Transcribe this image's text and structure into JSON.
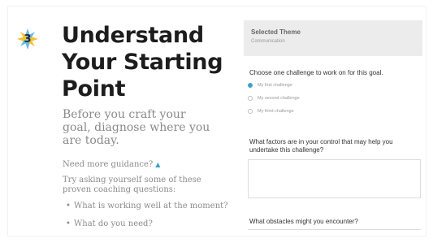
{
  "step": {
    "number": "3"
  },
  "left": {
    "title": "Understand Your Starting Point",
    "intro": "Before you craft your goal, diagnose where you are today.",
    "guidance_toggle": "Need more guidance?",
    "guidance_caret": "▲",
    "guidance_intro": "Try asking yourself some of these proven coaching questions:",
    "questions": [
      "What is working well at the moment?",
      "What do you need?"
    ]
  },
  "right": {
    "theme_label": "Selected Theme",
    "theme_value": "Communication",
    "choose_prompt": "Choose one challenge to work on for this goal.",
    "challenges": [
      {
        "label": "My first challenge",
        "checked": true
      },
      {
        "label": "My second challenge",
        "checked": false
      },
      {
        "label": "My third challenge",
        "checked": false
      }
    ],
    "factors_prompt": "What factors are in your control that may help you undertake this challenge?",
    "obstacles_prompt": "What obstacles might you encounter?"
  },
  "colors": {
    "accent": "#3aa0c8",
    "badge_yellow": "#f2c230",
    "badge_blue": "#6cb8df"
  }
}
